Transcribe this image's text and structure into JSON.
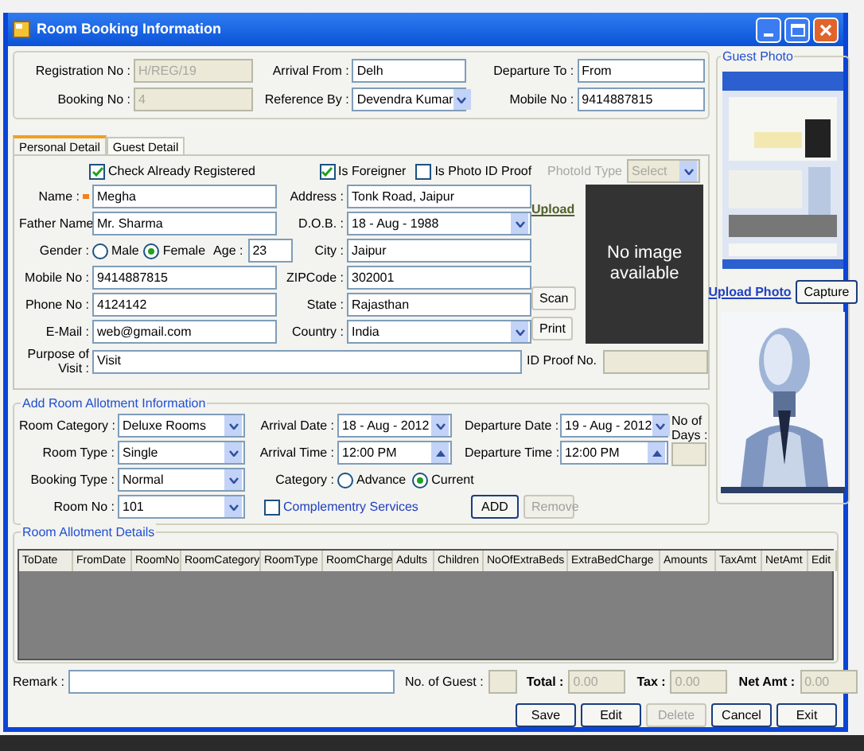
{
  "window": {
    "title": "Room Booking Information"
  },
  "booking": {
    "fields": [
      {
        "label": "Registration No :",
        "value": "H/REG/19",
        "kind": "text",
        "disabled": true
      },
      {
        "label": "Arrival From :",
        "value": "Delh",
        "kind": "text",
        "disabled": false
      },
      {
        "label": "Departure To :",
        "value": "From",
        "kind": "text",
        "disabled": false
      },
      {
        "label": "Booking No :",
        "value": "4",
        "kind": "text",
        "disabled": true
      },
      {
        "label": "Reference By :",
        "value": "Devendra Kumar",
        "kind": "dropdown",
        "disabled": false
      },
      {
        "label": "Mobile No :",
        "value": "9414887815",
        "kind": "text",
        "disabled": false
      }
    ]
  },
  "guest_photo": {
    "title": "Guest Photo",
    "upload_link": "Upload Photo",
    "capture_button": "Capture"
  },
  "tabs": [
    {
      "label": "Personal Detail",
      "selected": true
    },
    {
      "label": "Guest Detail",
      "selected": false
    }
  ],
  "personal": {
    "checks": [
      {
        "label": "Check Already Registered",
        "checked": true
      },
      {
        "label": "Is Foreigner",
        "checked": true
      },
      {
        "label": "Is Photo ID Proof",
        "checked": false
      }
    ],
    "photo_id_type": {
      "label": "PhotoId Type",
      "value": "Select",
      "disabled": true
    },
    "left_fields": [
      {
        "label": "Name :",
        "value": "Megha",
        "kind": "text",
        "required": true
      },
      {
        "label": "Father Name",
        "value": "Mr. Sharma",
        "kind": "text",
        "required": false
      },
      {
        "label": "Gender :",
        "kind": "gender",
        "options": [
          {
            "label": "Male",
            "selected": false
          },
          {
            "label": "Female",
            "selected": true
          }
        ],
        "age_label": "Age :",
        "age": "23"
      },
      {
        "label": "Mobile No :",
        "value": "9414887815",
        "kind": "text",
        "required": false
      },
      {
        "label": "Phone No :",
        "value": "4124142",
        "kind": "text",
        "required": false
      },
      {
        "label": "E-Mail :",
        "value": "web@gmail.com",
        "kind": "text",
        "required": false
      }
    ],
    "right_fields": [
      {
        "label": "Address :",
        "value": "Tonk Road, Jaipur",
        "kind": "text"
      },
      {
        "label": "D.O.B. :",
        "value": "18 - Aug - 1988",
        "kind": "dropdown"
      },
      {
        "label": "City :",
        "value": "Jaipur",
        "kind": "text"
      },
      {
        "label": "ZIPCode :",
        "value": "302001",
        "kind": "text"
      },
      {
        "label": "State :",
        "value": "Rajasthan",
        "kind": "text"
      },
      {
        "label": "Country :",
        "value": "India",
        "kind": "dropdown"
      }
    ],
    "upload_link": "Upload",
    "scan_button": "Scan",
    "print_button": "Print",
    "no_image_text": "No image available",
    "purpose": {
      "label": "Purpose of Visit :",
      "value": "Visit"
    },
    "id_proof": {
      "label": "ID Proof No.",
      "disabled": true
    }
  },
  "room_allotment": {
    "title": "Add Room Allotment Information",
    "fields": [
      {
        "label": "Room Category :",
        "value": "Deluxe Rooms",
        "kind": "dropdown"
      },
      {
        "label": "Arrival Date :",
        "value": "18 - Aug - 2012",
        "kind": "dropdown"
      },
      {
        "label": "Departure Date :",
        "value": "19 - Aug - 2012",
        "kind": "dropdown"
      },
      {
        "label": "Room Type :",
        "value": "Single",
        "kind": "dropdown"
      },
      {
        "label": "Arrival Time :",
        "value": "12:00 PM",
        "kind": "spin"
      },
      {
        "label": "Departure Time :",
        "value": "12:00 PM",
        "kind": "spin"
      },
      {
        "label": "Booking Type :",
        "value": "Normal",
        "kind": "dropdown"
      },
      {
        "label": "Category :",
        "kind": "radios",
        "options": [
          {
            "label": "Advance",
            "selected": false
          },
          {
            "label": "Current",
            "selected": true
          }
        ]
      },
      {
        "label": "Room No :",
        "value": "101",
        "kind": "dropdown"
      }
    ],
    "no_of_days_label": "No of Days :",
    "complementary": {
      "label": "Complementry Services",
      "checked": false
    },
    "add_button": "ADD",
    "remove_button": {
      "label": "Remove",
      "disabled": true
    }
  },
  "details": {
    "title": "Room Allotment Details",
    "columns": [
      "ToDate",
      "FromDate",
      "RoomNo",
      "RoomCategory",
      "RoomType",
      "RoomCharge",
      "Adults",
      "Children",
      "NoOfExtraBeds",
      "ExtraBedCharge",
      "Amounts",
      "TaxAmt",
      "NetAmt",
      "Edit"
    ]
  },
  "totals": {
    "remark_label": "Remark :",
    "guests_label": "No. of Guest :",
    "total_label": "Total :",
    "total": "0.00",
    "tax_label": "Tax :",
    "tax": "0.00",
    "net_label": "Net Amt :",
    "net": "0.00"
  },
  "buttons": [
    {
      "label": "Save",
      "disabled": false
    },
    {
      "label": "Edit",
      "disabled": false
    },
    {
      "label": "Delete",
      "disabled": true
    },
    {
      "label": "Cancel",
      "disabled": false
    },
    {
      "label": "Exit",
      "disabled": false
    }
  ]
}
